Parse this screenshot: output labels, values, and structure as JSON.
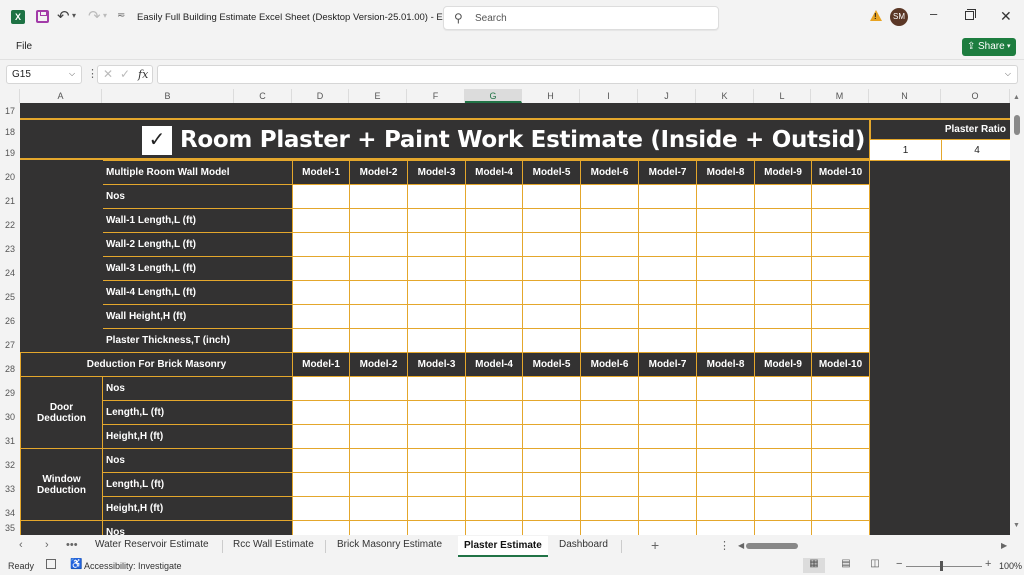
{
  "titlebar": {
    "app_icon": "excel-icon",
    "doc_title": "Easily Full Building Estimate Excel Sheet (Desktop Version-25.01.00)  -  E...",
    "search_placeholder": "Search",
    "avatar_initials": "SM",
    "icons": [
      "save-icon",
      "undo-icon",
      "redo-icon",
      "customize-quick-access-icon",
      "warning-icon",
      "minimize-icon",
      "restore-icon",
      "close-icon"
    ]
  },
  "ribbon": {
    "file_label": "File",
    "share_label": "Share"
  },
  "formula_bar": {
    "name_box": "G15",
    "formula": ""
  },
  "columns": [
    "A",
    "B",
    "C",
    "D",
    "E",
    "F",
    "G",
    "H",
    "I",
    "J",
    "K",
    "L",
    "M",
    "N",
    "O"
  ],
  "selected_column": "G",
  "rows": [
    "17",
    "18",
    "19",
    "20",
    "21",
    "22",
    "23",
    "24",
    "25",
    "26",
    "27",
    "28",
    "29",
    "30",
    "31",
    "32",
    "33",
    "34",
    "35"
  ],
  "sheet": {
    "title": "Room Plaster + Paint Work Estimate (Inside + Outsid)",
    "title_icon": "checkbox-icon",
    "plaster_ratio_label": "Plaster Ratio",
    "plaster_ratio_values": [
      "1",
      "4"
    ],
    "wall_section": {
      "header": "Multiple Room Wall Model",
      "models": [
        "Model-1",
        "Model-2",
        "Model-3",
        "Model-4",
        "Model-5",
        "Model-6",
        "Model-7",
        "Model-8",
        "Model-9",
        "Model-10"
      ],
      "rows": [
        "Nos",
        "Wall-1 Length,L (ft)",
        "Wall-2 Length,L (ft)",
        "Wall-3 Length,L (ft)",
        "Wall-4 Length,L (ft)",
        "Wall Height,H (ft)",
        "Plaster Thickness,T (inch)"
      ]
    },
    "deduction_section": {
      "header": "Deduction For Brick Masonry",
      "models": [
        "Model-1",
        "Model-2",
        "Model-3",
        "Model-4",
        "Model-5",
        "Model-6",
        "Model-7",
        "Model-8",
        "Model-9",
        "Model-10"
      ],
      "groups": [
        {
          "label": "Door Deduction",
          "rows": [
            "Nos",
            "Length,L (ft)",
            "Height,H (ft)"
          ]
        },
        {
          "label": "Window Deduction",
          "rows": [
            "Nos",
            "Length,L (ft)",
            "Height,H (ft)"
          ]
        },
        {
          "label": "",
          "rows": [
            "Nos"
          ]
        }
      ]
    }
  },
  "tabs": {
    "items": [
      "Water Reservoir Estimate",
      "Rcc Wall Estimate",
      "Brick Masonry Estimate",
      "Plaster Estimate",
      "Dashboard"
    ],
    "active": "Plaster Estimate"
  },
  "statusbar": {
    "ready": "Ready",
    "accessibility": "Accessibility: Investigate",
    "zoom": "100%"
  },
  "colors": {
    "sheet_bg": "#333232",
    "border_accent": "#e4a72c",
    "excel_green": "#217346",
    "share_green": "#1d7d3f"
  }
}
